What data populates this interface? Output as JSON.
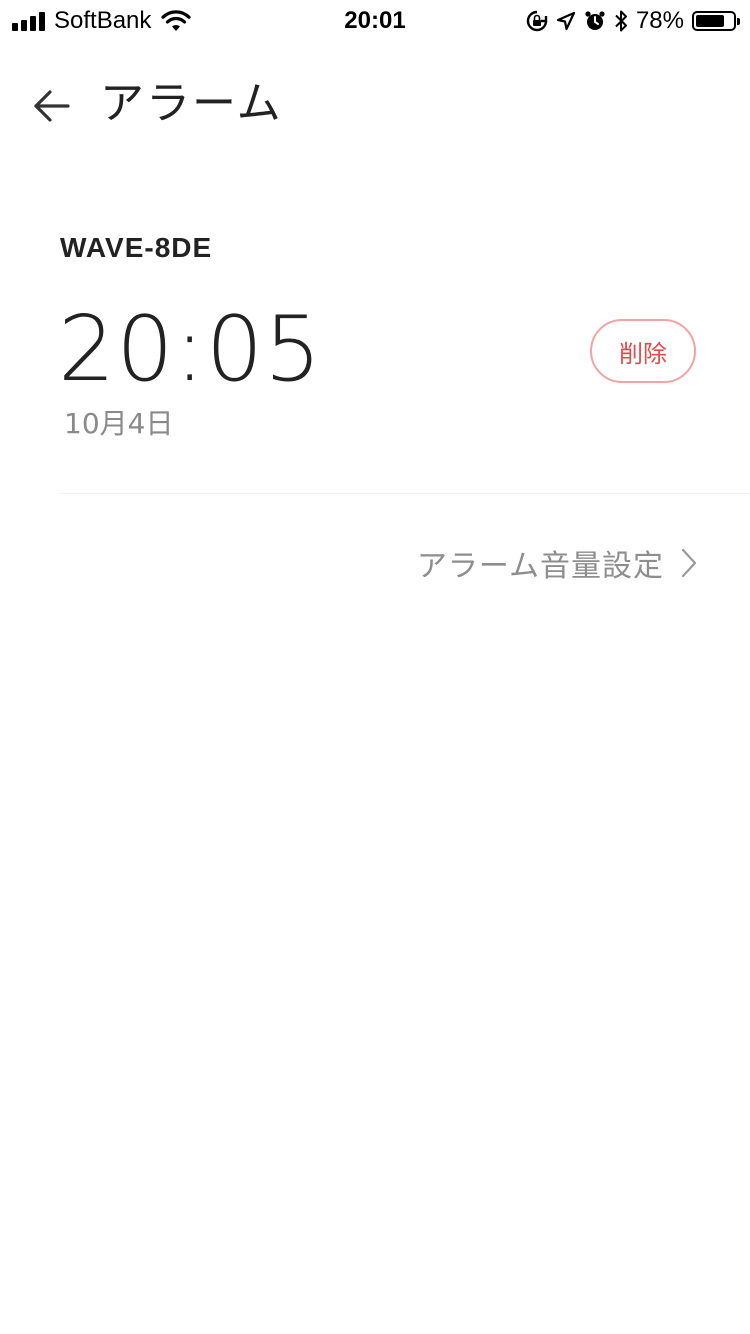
{
  "status_bar": {
    "carrier": "SoftBank",
    "time": "20:01",
    "battery_percent": "78%",
    "battery_level": 0.78,
    "icons": [
      "signal-icon",
      "wifi-icon",
      "orientation-lock-icon",
      "location-icon",
      "alarm-clock-icon",
      "bluetooth-icon",
      "battery-icon"
    ]
  },
  "header": {
    "title": "アラーム",
    "back_icon": "arrow-left-icon"
  },
  "alarm": {
    "device_name": "WAVE-8DE",
    "time": "20:05",
    "date": "10月4日",
    "delete_label": "削除"
  },
  "volume_settings": {
    "label": "アラーム音量設定",
    "icon": "chevron-right-icon"
  },
  "colors": {
    "delete_text": "#e34b4b",
    "delete_border": "#f2a3a3",
    "secondary_text": "#8e8e8e"
  }
}
